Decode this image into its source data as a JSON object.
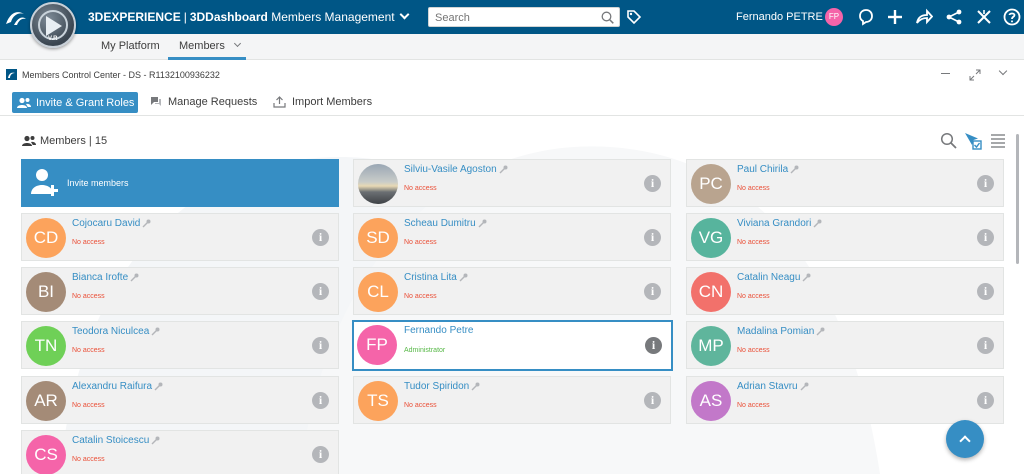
{
  "topbar": {
    "brand": "3DEXPERIENCE",
    "separator": "|",
    "app": "3DDashboard",
    "dashboard": "Members Management",
    "search_placeholder": "Search",
    "user_name": "Fernando PETRE",
    "user_initials": "FP",
    "compass_label": "V.R"
  },
  "tabs": [
    {
      "label": "My Platform"
    },
    {
      "label": "Members"
    }
  ],
  "widget": {
    "title": "Members Control Center - DS - R1132100936232"
  },
  "toolbar": {
    "invite": "Invite & Grant Roles",
    "manage": "Manage Requests",
    "import": "Import Members"
  },
  "members_header": {
    "label": "Members",
    "separator": "|",
    "count": "15"
  },
  "invite_card": {
    "label": "Invite members"
  },
  "members": [
    {
      "name": "Cojocaru David",
      "initials": "CD",
      "status": "No access",
      "color": "#fca35c"
    },
    {
      "name": "Bianca Irofte",
      "initials": "BI",
      "status": "No access",
      "color": "#a48b77"
    },
    {
      "name": "Teodora Niculcea",
      "initials": "TN",
      "status": "No access",
      "color": "#6fd057"
    },
    {
      "name": "Alexandru Raifura",
      "initials": "AR",
      "status": "No access",
      "color": "#a48b77"
    },
    {
      "name": "Catalin Stoicescu",
      "initials": "CS",
      "status": "No access",
      "color": "#f564a9"
    },
    {
      "name": "Silviu-Vasile Agoston",
      "initials": "",
      "status": "No access",
      "color": "#9aa7b4"
    },
    {
      "name": "Scheau Dumitru",
      "initials": "SD",
      "status": "No access",
      "color": "#fca35c"
    },
    {
      "name": "Cristina Lita",
      "initials": "CL",
      "status": "No access",
      "color": "#fca35c"
    },
    {
      "name": "Fernando Petre",
      "initials": "FP",
      "status": "Administrator",
      "color": "#f564a9"
    },
    {
      "name": "Tudor Spiridon",
      "initials": "TS",
      "status": "No access",
      "color": "#fca35c"
    },
    {
      "name": "Paul Chirila",
      "initials": "PC",
      "status": "No access",
      "color": "#b9a48f"
    },
    {
      "name": "Viviana Grandori",
      "initials": "VG",
      "status": "No access",
      "color": "#57b49d"
    },
    {
      "name": "Catalin Neagu",
      "initials": "CN",
      "status": "No access",
      "color": "#f2716b"
    },
    {
      "name": "Madalina Pomian",
      "initials": "MP",
      "status": "No access",
      "color": "#5fb59c"
    },
    {
      "name": "Adrian Stavru",
      "initials": "AS",
      "status": "No access",
      "color": "#c278c9"
    }
  ],
  "colors": {
    "topbar": "#005686",
    "accent": "#368ec4",
    "no_access": "#ea4f37",
    "admin": "#57b847"
  },
  "icons": [
    "ds-logo-icon",
    "compass-icon",
    "search-icon",
    "tag-icon",
    "chat-icon",
    "plus-icon",
    "share-icon",
    "network-icon",
    "tools-icon",
    "help-icon",
    "key-icon",
    "info-icon",
    "chevron-up-icon"
  ]
}
